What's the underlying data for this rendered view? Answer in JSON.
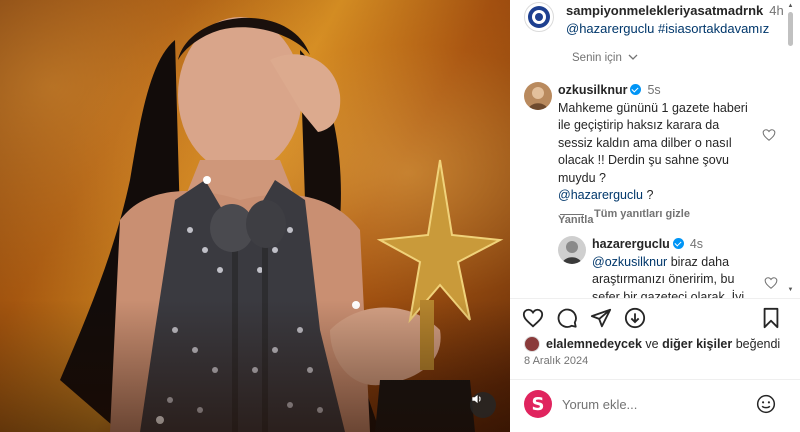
{
  "post": {
    "author": "sampiyonmelekleriyasatmadrnk",
    "time": "4h",
    "caption_mention": "@hazarerguclu",
    "caption_hashtag": "#isiasortakdavamız",
    "translate_label": "Senin için"
  },
  "comments": [
    {
      "username": "ozkusilknur",
      "time": "5s",
      "text": "Mahkeme gününü 1 gazete haberi ile geçiştirip haksız karara da sessiz kaldın ama dilber o nasıl olacak !! Derdin şu sahne şovu muydu ?",
      "mention": "@hazarerguclu",
      "mention_suffix": " ?",
      "reply_label": "Yanıtla"
    }
  ],
  "hide_replies_label": "Tüm yanıtları gizle",
  "reply": {
    "username": "hazarerguclu",
    "time": "4s",
    "mention": "@ozkusilknur",
    "text": " biraz daha araştırmanızı öneririm, bu sefer bir gazeteci olarak. İyi"
  },
  "likes": {
    "first_user": "elalemnedeycek",
    "connector": " ve ",
    "others": "diğer kişiler",
    "suffix": " beğendi"
  },
  "date": "8 Aralık 2024",
  "comment_box": {
    "placeholder": "Yorum ekle...",
    "avatar_letter": "S"
  },
  "colors": {
    "link": "#00376b",
    "verified": "#0095f6",
    "muted": "#737373",
    "text": "#262626"
  },
  "icons": {
    "like": "heart-outline-icon",
    "comment": "comment-bubble-icon",
    "share": "paper-plane-icon",
    "repost": "repost-circle-icon",
    "save": "bookmark-icon",
    "mute": "speaker-icon",
    "emoji": "smiley-icon"
  }
}
